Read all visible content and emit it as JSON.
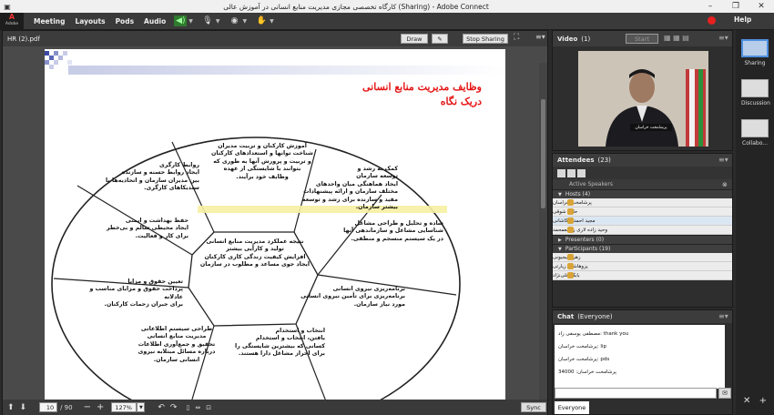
{
  "window": {
    "title": "کارگاه تخصصی مجازی مدیریت منابع انسانی در آموزش عالی (Sharing) - Adobe Connect",
    "controls": [
      "–",
      "❐",
      "✕"
    ]
  },
  "appbar": {
    "logo_letter": "A",
    "logo_text": "Adobe",
    "menus": [
      "Meeting",
      "Layouts",
      "Pods",
      "Audio"
    ],
    "help": "Help"
  },
  "share_pod": {
    "filename": "HR (2).pdf",
    "draw_label": "Draw",
    "stop_label": "Stop Sharing",
    "page_current": "10",
    "page_total": "/ 90",
    "zoom": "127%",
    "sync_label": "Sync"
  },
  "slide": {
    "title_line1": "وظایف مدیریت منابع انسانی",
    "title_line2": "دریک نگاه",
    "center": "نتیجه عملکرد مدیریت منابع انسانی\nتولید و کارآیی بیشتر\nافزایش کیفیت زندگی کاری کارکنان\nایجاد جوی مساعد و مطلوب در سازمان",
    "sectors": [
      "آموزش کارکنان و تربیت مدیران\nشناخت توانها و استعدادهای کارکنان\nو تربیت و پرورش آنها به طوری که\nبتوانند با شایستگی از عهده\nوظایف خود برآیند.",
      "کمک به رشد و\nتوسعه سازمان\nایجاد هماهنگی میان واحدهای\nمختلف سازمان و ارائه پیشنهادات\nمفید و سازنده برای رشد و توسعه\nبیشتر سازمان.",
      "ساده و تحلیل و طراحی مشاغل\nشناسایی مشاغل و سازماندهی آنها\nدر یک سیستم منسجم و منطقی.",
      "برنامه‌ریزی نیروی انسانی\nبرنامه‌ریزی برای تأمین نیروی انسانی\nمورد نیاز سازمان.",
      "انتخاب و استخدام\nیافتن، انتخاب و استخدام\nکسانی که بیشترین شایستگی را\nبرای احراز مشاغل دارا هستند.",
      "طراحی سیستم اطلاعاتی\nمدیریت منابع انسانی\nتحقیق و جمع‌آوری اطلاعات\nدرباره مسائل مبتلابه نیروی\nانسانی سازمان.",
      "تعیین حقوق و مزایا\nپرداخت حقوق و مزایای مناسب و عادلانه\nبرای جبران زحمات کارکنان.",
      "حفظ بهداشت و ایمنی\nایجاد محیطی سالم و بی‌خطر\nبرای کار و فعالیت.",
      "روابط کارگری\nایجاد روابط حسنه و سازنده\nبین مدیران سازمان و اتحادیه‌ها یا سندیکاهای کارگری."
    ]
  },
  "video_pod": {
    "title": "Video",
    "count": "(1)",
    "start_label": "Start",
    "name_strip": "پرشامخت خراسان"
  },
  "attendees_pod": {
    "title": "Attendees",
    "count": "(23)",
    "active_speakers": "Active Speakers",
    "hosts_label": "Hosts (4)",
    "hosts": [
      "پرشامخت خراسان",
      "حامد شوقی",
      "مجید احمدی کاشانی",
      "وحید زاده لاری زیسعمحمد"
    ],
    "presenters_label": "Presenters (0)",
    "participants_label": "Participants (19)",
    "participants": [
      "زهره بیجیونی",
      "پزوهاشین زیارتی",
      "بابک علی‌نژاد"
    ]
  },
  "chat_pod": {
    "title": "Chat",
    "scope": "(Everyone)",
    "messages": [
      "مصطفی یوسفی زاد: thank you",
      "پرشامخت خراسان: lip",
      "پرشامخت خراسان: pds",
      "پرشامخت خراسان: 34000"
    ],
    "tab": "Everyone"
  },
  "layouts_rail": {
    "items": [
      "Sharing",
      "Discussion",
      "Collabo..."
    ]
  },
  "colors": {
    "title_red": "#e41414",
    "record_red": "#e82020",
    "selected_layout": "#4f8fe0"
  }
}
